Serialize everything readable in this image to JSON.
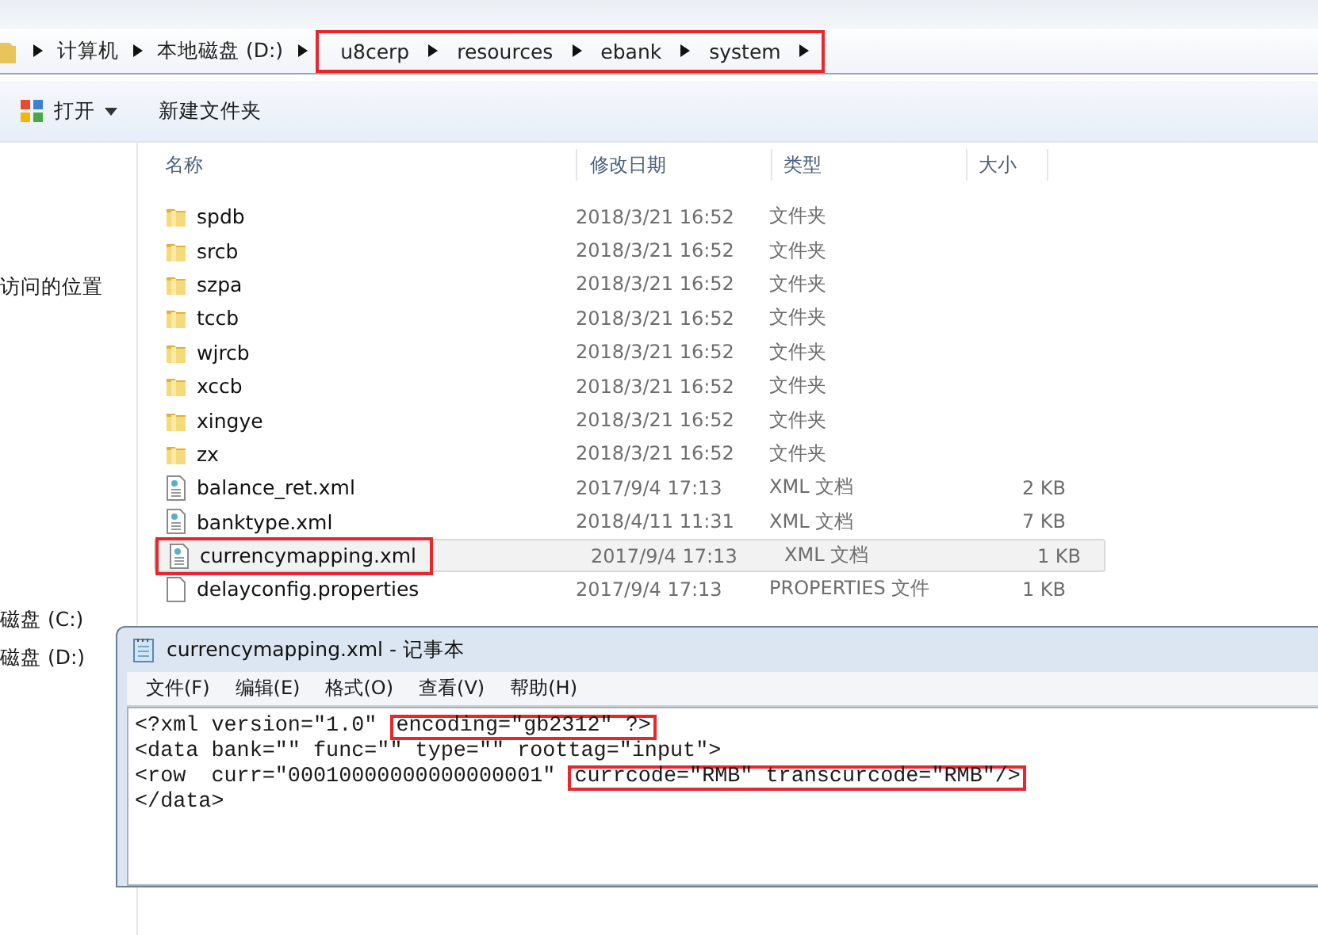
{
  "breadcrumb": [
    {
      "label": "计算机",
      "highlighted": false
    },
    {
      "label": "本地磁盘 (D:)",
      "highlighted": false
    },
    {
      "label": "u8cerp",
      "highlighted": true
    },
    {
      "label": "resources",
      "highlighted": true
    },
    {
      "label": "ebank",
      "highlighted": true
    },
    {
      "label": "system",
      "highlighted": true
    }
  ],
  "toolbar": {
    "open": "打开",
    "new_folder": "新建文件夹"
  },
  "sidebar": [
    {
      "label": "访问的位置"
    },
    {
      "label": "磁盘 (C:)"
    },
    {
      "label": "磁盘 (D:)"
    }
  ],
  "columns": [
    "名称",
    "修改日期",
    "类型",
    "大小"
  ],
  "files": [
    {
      "kind": "folder",
      "name": "spdb",
      "date": "2018/3/21 16:52",
      "type": "文件夹",
      "selected": false,
      "highlighted": false
    },
    {
      "kind": "folder",
      "name": "srcb",
      "date": "2018/3/21 16:52",
      "type": "文件夹",
      "selected": false,
      "highlighted": false
    },
    {
      "kind": "folder",
      "name": "szpa",
      "date": "2018/3/21 16:52",
      "type": "文件夹",
      "selected": false,
      "highlighted": false
    },
    {
      "kind": "folder",
      "name": "tccb",
      "date": "2018/3/21 16:52",
      "type": "文件夹",
      "selected": false,
      "highlighted": false
    },
    {
      "kind": "folder",
      "name": "wjrcb",
      "date": "2018/3/21 16:52",
      "type": "文件夹",
      "selected": false,
      "highlighted": false
    },
    {
      "kind": "folder",
      "name": "xccb",
      "date": "2018/3/21 16:52",
      "type": "文件夹",
      "selected": false,
      "highlighted": false
    },
    {
      "kind": "folder",
      "name": "xingye",
      "date": "2018/3/21 16:52",
      "type": "文件夹",
      "selected": false,
      "highlighted": false
    },
    {
      "kind": "folder",
      "name": "zx",
      "date": "2018/3/21 16:52",
      "type": "文件夹",
      "selected": false,
      "highlighted": false
    },
    {
      "kind": "xml",
      "name": "balance_ret.xml",
      "date": "2017/9/4 17:13",
      "type": "XML 文档",
      "size": "2 KB",
      "selected": false,
      "highlighted": false
    },
    {
      "kind": "xml",
      "name": "banktype.xml",
      "date": "2018/4/11 11:31",
      "type": "XML 文档",
      "size": "7 KB",
      "selected": false,
      "highlighted": false
    },
    {
      "kind": "xml",
      "name": "currencymapping.xml",
      "date": "2017/9/4 17:13",
      "type": "XML 文档",
      "size": "1 KB",
      "selected": true,
      "highlighted": true
    },
    {
      "kind": "file",
      "name": "delayconfig.properties",
      "date": "2017/9/4 17:13",
      "type": "PROPERTIES 文件",
      "size": "1 KB",
      "selected": false,
      "highlighted": false
    }
  ],
  "notepad": {
    "title": "currencymapping.xml - 记事本",
    "menu": [
      "文件(F)",
      "编辑(E)",
      "格式(O)",
      "查看(V)",
      "帮助(H)"
    ],
    "lines": [
      [
        {
          "text": "<?xml version=\"1.0\" ",
          "highlighted": false
        },
        {
          "text": "encoding=\"gb2312\" ?>",
          "highlighted": true
        }
      ],
      [
        {
          "text": "<data bank=\"\" func=\"\" type=\"\" roottag=\"input\">",
          "highlighted": false
        }
      ],
      [
        {
          "text": "<row  curr=\"00010000000000000001\" ",
          "highlighted": false
        },
        {
          "text": "currcode=\"RMB\" transcurcode=\"RMB\"/>",
          "highlighted": true
        }
      ],
      [
        {
          "text": "</data>",
          "highlighted": false
        }
      ]
    ]
  }
}
